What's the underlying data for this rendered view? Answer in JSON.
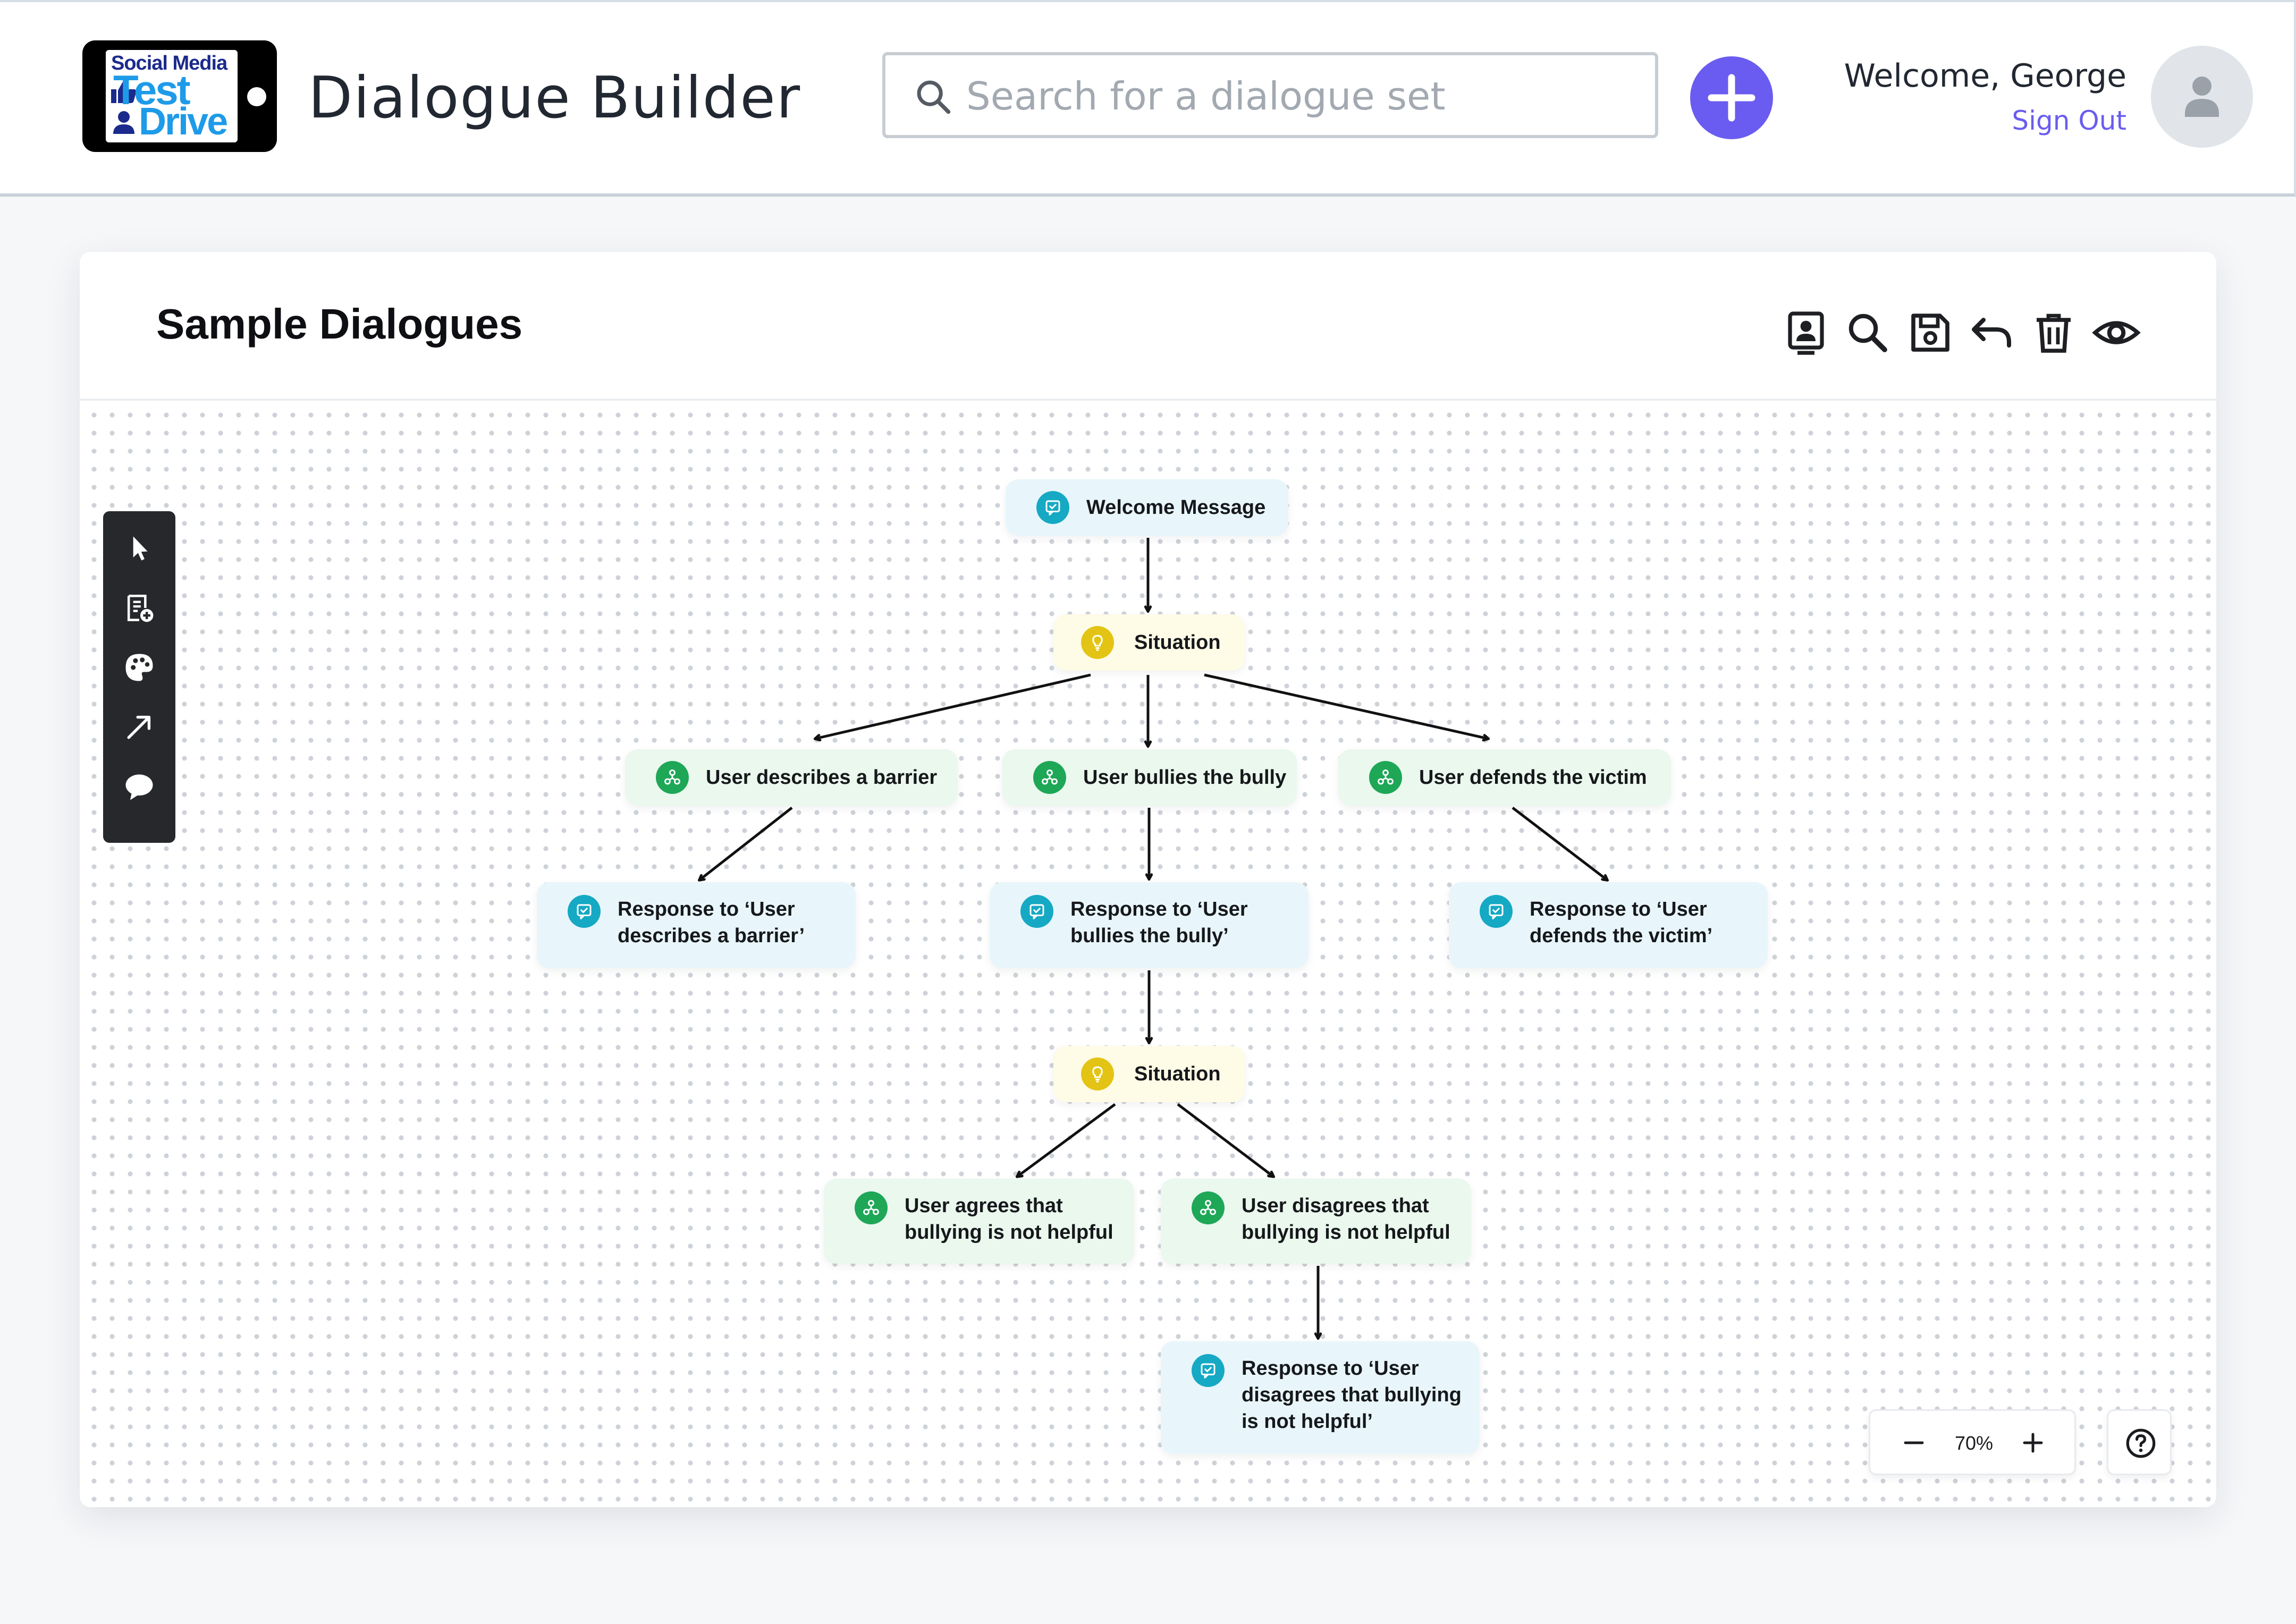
{
  "header": {
    "logo": {
      "line1": "Social Media",
      "line2": "Test",
      "line3": "Drive"
    },
    "title": "Dialogue Builder",
    "search": {
      "placeholder": "Search for a dialogue set",
      "value": ""
    },
    "add_button_icon": "plus-icon",
    "welcome": "Welcome, George",
    "sign_out": "Sign Out",
    "avatar_icon": "user-icon"
  },
  "card": {
    "title": "Sample Dialogues",
    "toolbar": [
      {
        "name": "contact-card-icon"
      },
      {
        "name": "search-icon"
      },
      {
        "name": "save-icon"
      },
      {
        "name": "undo-icon"
      },
      {
        "name": "delete-icon"
      },
      {
        "name": "preview-eye-icon"
      }
    ]
  },
  "palette": [
    {
      "name": "select-pointer-icon"
    },
    {
      "name": "add-note-icon"
    },
    {
      "name": "palette-icon"
    },
    {
      "name": "connector-arrow-icon"
    },
    {
      "name": "comment-bubble-icon"
    }
  ],
  "flow": {
    "nodes": [
      {
        "id": "welcome",
        "type": "message",
        "label": "Welcome Message"
      },
      {
        "id": "situation1",
        "type": "situation",
        "label": "Situation"
      },
      {
        "id": "user_barrier",
        "type": "user",
        "label": "User describes a barrier"
      },
      {
        "id": "user_bully",
        "type": "user",
        "label": "User bullies the bully"
      },
      {
        "id": "user_defends",
        "type": "user",
        "label": "User defends the victim"
      },
      {
        "id": "resp_barrier",
        "type": "message",
        "label": "Response to ‘User\ndescribes a barrier’"
      },
      {
        "id": "resp_bully",
        "type": "message",
        "label": "Response to ‘User\nbullies the bully’"
      },
      {
        "id": "resp_defends",
        "type": "message",
        "label": "Response to ‘User\ndefends the victim’"
      },
      {
        "id": "situation2",
        "type": "situation",
        "label": "Situation"
      },
      {
        "id": "user_agrees",
        "type": "user",
        "label": "User agrees that\nbullying is not helpful"
      },
      {
        "id": "user_disagrees",
        "type": "user",
        "label": "User disagrees that\nbullying is not helpful"
      },
      {
        "id": "resp_disagrees",
        "type": "message",
        "label": "Response to ‘User\ndisagrees that bullying\nis not helpful’"
      }
    ],
    "edges": [
      [
        "welcome",
        "situation1"
      ],
      [
        "situation1",
        "user_barrier"
      ],
      [
        "situation1",
        "user_bully"
      ],
      [
        "situation1",
        "user_defends"
      ],
      [
        "user_barrier",
        "resp_barrier"
      ],
      [
        "user_bully",
        "resp_bully"
      ],
      [
        "user_defends",
        "resp_defends"
      ],
      [
        "resp_bully",
        "situation2"
      ],
      [
        "situation2",
        "user_agrees"
      ],
      [
        "situation2",
        "user_disagrees"
      ],
      [
        "user_disagrees",
        "resp_disagrees"
      ]
    ]
  },
  "zoom": {
    "value": "70%",
    "minus_icon": "minus-icon",
    "plus_icon": "plus-icon"
  },
  "help_icon": "help-icon",
  "colors": {
    "accent": "#6a5cf0",
    "message_node": "#e8f6fb",
    "situation_node": "#fefbe6",
    "user_node": "#eaf8ee",
    "message_icon": "#15a9c4",
    "situation_icon": "#e3c414",
    "user_icon": "#1ea757"
  }
}
